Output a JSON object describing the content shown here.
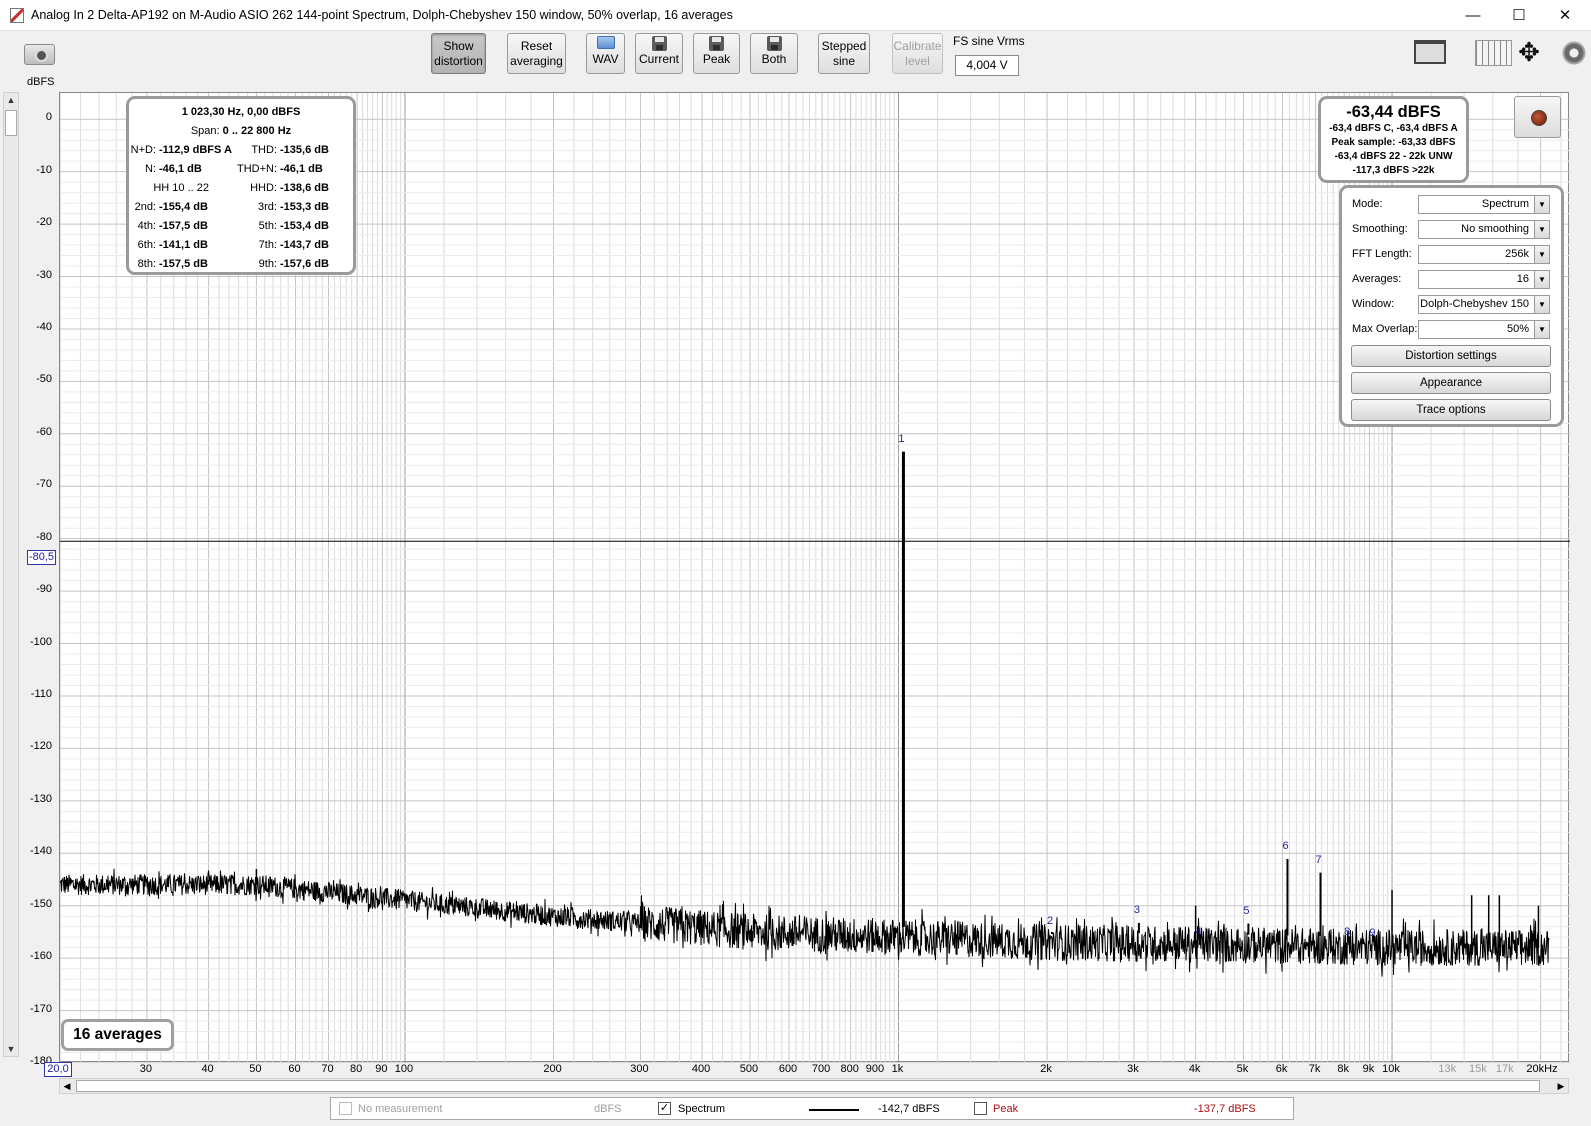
{
  "window": {
    "title": "Analog In 2 Delta-AP192 on M-Audio ASIO 262 144-point Spectrum, Dolph-Chebyshev 150 window, 50% overlap, 16 averages",
    "minimize": "—",
    "maximize": "☐",
    "close": "✕"
  },
  "toolbar": {
    "show_distortion": [
      "Show",
      "distortion"
    ],
    "reset_averaging": [
      "Reset",
      "averaging"
    ],
    "wav": "WAV",
    "current": "Current",
    "peak": "Peak",
    "both": "Both",
    "stepped_sine": [
      "Stepped",
      "sine"
    ],
    "calibrate_level": [
      "Calibrate",
      "level"
    ],
    "fs_label": "FS sine Vrms",
    "fs_value": "4,004 V"
  },
  "axis": {
    "y_unit": "dBFS",
    "y_ticks": [
      "0",
      "-10",
      "-20",
      "-30",
      "-40",
      "-50",
      "-60",
      "-70",
      "-80",
      "-90",
      "-100",
      "-110",
      "-120",
      "-130",
      "-140",
      "-150",
      "-160",
      "-170",
      "-180"
    ],
    "x_ticks": [
      "30",
      "40",
      "50",
      "60",
      "70",
      "80",
      "90",
      "100",
      "200",
      "300",
      "400",
      "500",
      "600",
      "700",
      "800",
      "900",
      "1k",
      "2k",
      "3k",
      "4k",
      "5k",
      "6k",
      "7k",
      "8k",
      "9k",
      "10k",
      "13k",
      "15k",
      "17k",
      "20kHz"
    ],
    "x_cursor_value": "20,0",
    "y_cursor_value": "-80,5"
  },
  "distortion_panel": {
    "freq_line": "1 023,30 Hz, 0,00 dBFS",
    "span_label": "Span:",
    "span_value": "0 .. 22 800 Hz",
    "rows": [
      {
        "l_label": "N+D:",
        "l_value": "-112,9 dBFS A",
        "r_label": "THD:",
        "r_value": "-135,6 dB"
      },
      {
        "l_label": "N:",
        "l_value": "-46,1 dB",
        "r_label": "THD+N:",
        "r_value": "-46,1 dB"
      },
      {
        "l_label": "HH 10 .. 22",
        "l_value": "",
        "r_label": "HHD:",
        "r_value": "-138,6 dB"
      },
      {
        "l_label": "2nd:",
        "l_value": "-155,4 dB",
        "r_label": "3rd:",
        "r_value": "-153,3 dB"
      },
      {
        "l_label": "4th:",
        "l_value": "-157,5 dB",
        "r_label": "5th:",
        "r_value": "-153,4 dB"
      },
      {
        "l_label": "6th:",
        "l_value": "-141,1 dB",
        "r_label": "7th:",
        "r_value": "-143,7 dB"
      },
      {
        "l_label": "8th:",
        "l_value": "-157,5 dB",
        "r_label": "9th:",
        "r_value": "-157,6 dB"
      }
    ]
  },
  "level_panel": {
    "main": "-63,44 dBFS",
    "lines": [
      "-63,4 dBFS C, -63,4 dBFS A",
      "Peak sample: -63,33 dBFS",
      "-63,4 dBFS 22 - 22k UNW",
      "-117,3 dBFS >22k"
    ]
  },
  "controls": {
    "mode": {
      "label": "Mode:",
      "value": "Spectrum"
    },
    "smoothing": {
      "label": "Smoothing:",
      "value": "No  smoothing"
    },
    "fft_length": {
      "label": "FFT Length:",
      "value": "256k"
    },
    "averages": {
      "label": "Averages:",
      "value": "16"
    },
    "window": {
      "label": "Window:",
      "value": "Dolph-Chebyshev 150"
    },
    "max_overlap": {
      "label": "Max Overlap:",
      "value": "50%"
    },
    "distortion_settings": "Distortion settings",
    "appearance": "Appearance",
    "trace_options": "Trace options"
  },
  "averages_badge": "16 averages",
  "legend": {
    "no_measurement": "No measurement",
    "no_measurement_unit": "dBFS",
    "spectrum_label": "Spectrum",
    "spectrum_value": "-142,7 dBFS",
    "peak_label": "Peak",
    "peak_value": "-137,7 dBFS",
    "spectrum_checked": "✓"
  },
  "chart_data": {
    "type": "line",
    "x_scale": "log",
    "xlim": [
      20,
      22000
    ],
    "ylim": [
      -180,
      5
    ],
    "ylabel": "dBFS",
    "grid": true,
    "cursor_level_dbfs": -80.5,
    "harmonic_labels": [
      {
        "n": "1",
        "freq": 1023.3,
        "level": -63.4
      },
      {
        "n": "2",
        "freq": 2046.6,
        "level": -155.4
      },
      {
        "n": "3",
        "freq": 3069.9,
        "level": -153.3
      },
      {
        "n": "4",
        "freq": 4093.2,
        "level": -157.5
      },
      {
        "n": "5",
        "freq": 5116.5,
        "level": -153.4
      },
      {
        "n": "6",
        "freq": 6139.8,
        "level": -141.1
      },
      {
        "n": "7",
        "freq": 7163.1,
        "level": -143.7
      },
      {
        "n": "8",
        "freq": 8186.4,
        "level": -157.5
      },
      {
        "n": "9",
        "freq": 9209.7,
        "level": -157.6
      }
    ],
    "noise_floor": [
      [
        20,
        -146
      ],
      [
        50,
        -146
      ],
      [
        100,
        -149
      ],
      [
        200,
        -152
      ],
      [
        500,
        -155
      ],
      [
        1000,
        -156
      ],
      [
        2000,
        -157
      ],
      [
        5000,
        -157.5
      ],
      [
        10000,
        -158
      ],
      [
        20000,
        -158
      ]
    ],
    "spurs": [
      [
        40,
        -145
      ],
      [
        50,
        -143
      ],
      [
        4000,
        -150
      ],
      [
        10000,
        -147
      ],
      [
        14500,
        -148
      ],
      [
        15700,
        -148
      ],
      [
        16500,
        -148
      ],
      [
        19800,
        -150
      ]
    ],
    "colors": {
      "trace": "#000000",
      "grid_major": "#9a9a9a",
      "grid_minor": "#dcdcdc",
      "harmonic_label": "#2222aa"
    }
  }
}
